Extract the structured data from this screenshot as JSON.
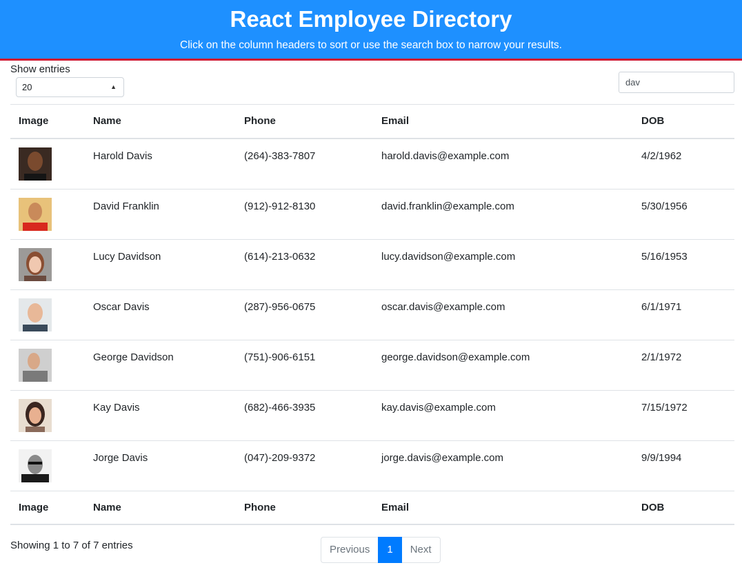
{
  "header": {
    "title": "React Employee Directory",
    "subtitle": "Click on the column headers to sort or use the search box to narrow your results."
  },
  "controls": {
    "show_entries_label": "Show entries",
    "entries_value": "20",
    "search_value": "dav"
  },
  "table": {
    "columns": [
      "Image",
      "Name",
      "Phone",
      "Email",
      "DOB"
    ],
    "rows": [
      {
        "name": "Harold Davis",
        "phone": "(264)-383-7807",
        "email": "harold.davis@example.com",
        "dob": "4/2/1962"
      },
      {
        "name": "David Franklin",
        "phone": "(912)-912-8130",
        "email": "david.franklin@example.com",
        "dob": "5/30/1956"
      },
      {
        "name": "Lucy Davidson",
        "phone": "(614)-213-0632",
        "email": "lucy.davidson@example.com",
        "dob": "5/16/1953"
      },
      {
        "name": "Oscar Davis",
        "phone": "(287)-956-0675",
        "email": "oscar.davis@example.com",
        "dob": "6/1/1971"
      },
      {
        "name": "George Davidson",
        "phone": "(751)-906-6151",
        "email": "george.davidson@example.com",
        "dob": "2/1/1972"
      },
      {
        "name": "Kay Davis",
        "phone": "(682)-466-3935",
        "email": "kay.davis@example.com",
        "dob": "7/15/1972"
      },
      {
        "name": "Jorge Davis",
        "phone": "(047)-209-9372",
        "email": "jorge.davis@example.com",
        "dob": "9/9/1994"
      }
    ]
  },
  "footer": {
    "status": "Showing 1 to 7 of 7 entries",
    "pagination": {
      "previous": "Previous",
      "current": "1",
      "next": "Next"
    }
  },
  "colors": {
    "header_bg": "#1e90ff",
    "header_border": "#d4152e",
    "page_active": "#007bff"
  }
}
